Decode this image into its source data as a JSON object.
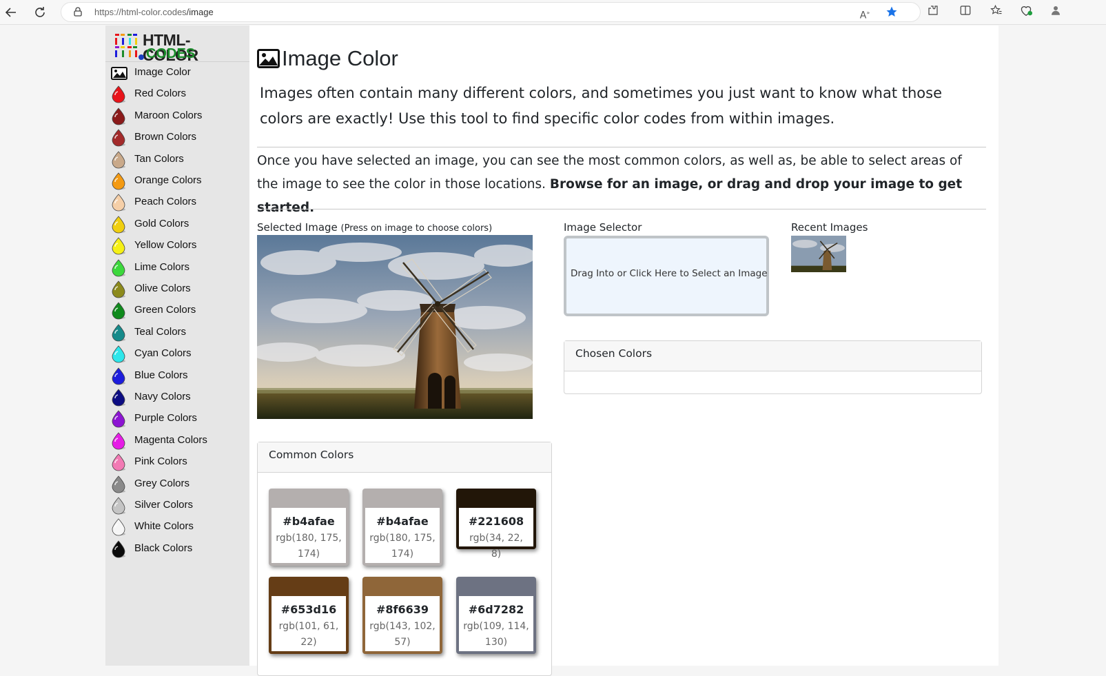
{
  "browser": {
    "url_host": "https://html-color.codes",
    "url_path": "/image"
  },
  "logo": {
    "line1": "HTML-COLOR",
    "line2": "CODES"
  },
  "sidebar": {
    "items": [
      {
        "label": "Image Color",
        "color": "#000000",
        "icon": "image-icon"
      },
      {
        "label": "Red Colors",
        "color": "#e8141a"
      },
      {
        "label": "Maroon Colors",
        "color": "#8b1a1a"
      },
      {
        "label": "Brown Colors",
        "color": "#a32a2a"
      },
      {
        "label": "Tan Colors",
        "color": "#c9a98a"
      },
      {
        "label": "Orange Colors",
        "color": "#f49a12"
      },
      {
        "label": "Peach Colors",
        "color": "#f5cfa8"
      },
      {
        "label": "Gold Colors",
        "color": "#f0cf0f"
      },
      {
        "label": "Yellow Colors",
        "color": "#f5f016"
      },
      {
        "label": "Lime Colors",
        "color": "#3cd83c"
      },
      {
        "label": "Olive Colors",
        "color": "#8c8a1c"
      },
      {
        "label": "Green Colors",
        "color": "#0f8a1c"
      },
      {
        "label": "Teal Colors",
        "color": "#168a8a"
      },
      {
        "label": "Cyan Colors",
        "color": "#2de6ea"
      },
      {
        "label": "Blue Colors",
        "color": "#1c1cdc"
      },
      {
        "label": "Navy Colors",
        "color": "#0c0c82"
      },
      {
        "label": "Purple Colors",
        "color": "#8c14d2"
      },
      {
        "label": "Magenta Colors",
        "color": "#e61ce6"
      },
      {
        "label": "Pink Colors",
        "color": "#f27ab4"
      },
      {
        "label": "Grey Colors",
        "color": "#8a8a8a"
      },
      {
        "label": "Silver Colors",
        "color": "#c4c4c4"
      },
      {
        "label": "White Colors",
        "color": "#f6f6f6"
      },
      {
        "label": "Black Colors",
        "color": "#0a0a0a"
      }
    ]
  },
  "main": {
    "title": "Image Color",
    "lead": "Images often contain many different colors, and sometimes you just want to know what those colors are exactly! Use this tool to find specific color codes from within images.",
    "para_text": "Once you have selected an image, you can see the most common colors, as well as, be able to select areas of the image to see the color in those locations. ",
    "para_bold": "Browse for an image, or drag and drop your image to get started.",
    "selected_label": "Selected Image ",
    "selected_hint": "(Press on image to choose colors)",
    "selector_label": "Image Selector",
    "dropzone_text": "Drag Into or Click Here to Select an Image",
    "recent_label": "Recent Images",
    "chosen_header": "Chosen Colors",
    "common_header": "Common Colors"
  },
  "common_colors": [
    {
      "hex": "#b4afae",
      "rgb": "rgb(180, 175, 174)"
    },
    {
      "hex": "#b4afae",
      "rgb": "rgb(180, 175, 174)"
    },
    {
      "hex": "#221608",
      "rgb": "rgb(34, 22, 8)"
    },
    {
      "hex": "#653d16",
      "rgb": "rgb(101, 61, 22)"
    },
    {
      "hex": "#8f6639",
      "rgb": "rgb(143, 102, 57)"
    },
    {
      "hex": "#6d7282",
      "rgb": "rgb(109, 114, 130)"
    }
  ]
}
